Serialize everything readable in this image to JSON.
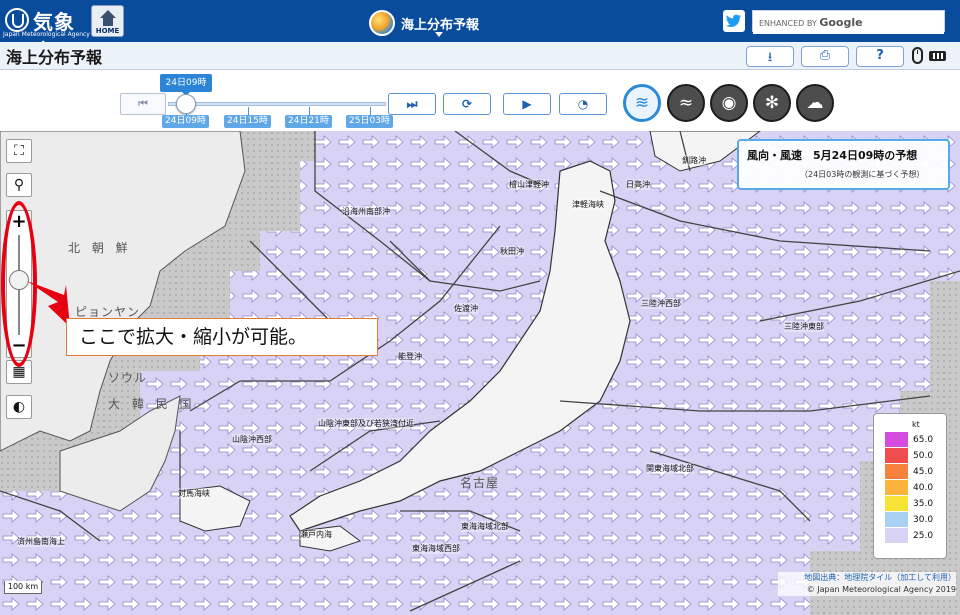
{
  "header": {
    "agency_name": "気象庁",
    "agency_name_en": "Japan Meteorological Agency",
    "home_label": "HOME",
    "app_title": "海上分布予報",
    "search_placeholder_prefix": "ENHANCED BY",
    "search_placeholder_brand": "Google"
  },
  "titlebar": {
    "page_title": "海上分布予報",
    "buttons": [
      {
        "name": "download",
        "glyph": "⭳"
      },
      {
        "name": "print",
        "glyph": "⎙"
      },
      {
        "name": "help",
        "glyph": "?"
      }
    ]
  },
  "time": {
    "current": "24日09時",
    "labels": [
      "24日09時",
      "24日15時",
      "24日21時",
      "25日03時"
    ],
    "first_glyph": "⏮",
    "next_glyph": "⏭",
    "refresh_glyph": "⟳",
    "play_glyph": "▶",
    "speed_glyph": "◔"
  },
  "layers": [
    {
      "name": "wind",
      "glyph": "≋",
      "active": true
    },
    {
      "name": "wave",
      "glyph": "≈",
      "active": false
    },
    {
      "name": "visibility",
      "glyph": "◉",
      "active": false
    },
    {
      "name": "icing",
      "glyph": "✻",
      "active": false
    },
    {
      "name": "weather",
      "glyph": "☁",
      "active": false
    }
  ],
  "map": {
    "controls": {
      "fit_glyph": "⛶",
      "pin_glyph": "⚲",
      "zoom_in": "+",
      "zoom_out": "−",
      "basemap_glyph": "▦",
      "drop_glyph": "◐"
    },
    "callout": "ここで拡大・縮小が可能。",
    "info_title": "風向・風速　5月24日09時の予想",
    "info_sub": "（24日03時の観測に基づく予想）",
    "place_labels": [
      "北 朝 鮮",
      "ピョンヤン",
      "ソウル",
      "大 韓 民 国",
      "名古屋"
    ],
    "zone_labels": [
      "津軽海峡",
      "日高沖",
      "檜山津軽沖",
      "沿海州南部沖",
      "秋田沖",
      "三陸沖西部",
      "三陸沖東部",
      "佐渡沖",
      "能登沖",
      "山陰沖東部及び若狭湾付近",
      "山陰沖西部",
      "関東海域北部",
      "対馬海峡",
      "東海海域北部",
      "東海海域西部",
      "瀬戸内海",
      "済州島南海上",
      "釧路沖"
    ],
    "legend": {
      "unit": "kt",
      "levels": [
        {
          "label": "65.0",
          "color": "#d64be0"
        },
        {
          "label": "50.0",
          "color": "#f04e4e"
        },
        {
          "label": "45.0",
          "color": "#f7823e"
        },
        {
          "label": "40.0",
          "color": "#fbb33c"
        },
        {
          "label": "35.0",
          "color": "#f7e236"
        },
        {
          "label": "30.0",
          "color": "#a7d0f3"
        },
        {
          "label": "25.0",
          "color": "#d8d2f5"
        }
      ]
    },
    "scale": "100 km",
    "attribution_line1": "地図出典：地理院タイル（加工して利用）",
    "attribution_line2": "© Japan Meteorological Agency 2019"
  },
  "colors": {
    "header_bg": "#0a4c9c",
    "accent": "#2a8ad8",
    "wind_area": "#d8d2f5",
    "annotation_red": "#e60012"
  }
}
